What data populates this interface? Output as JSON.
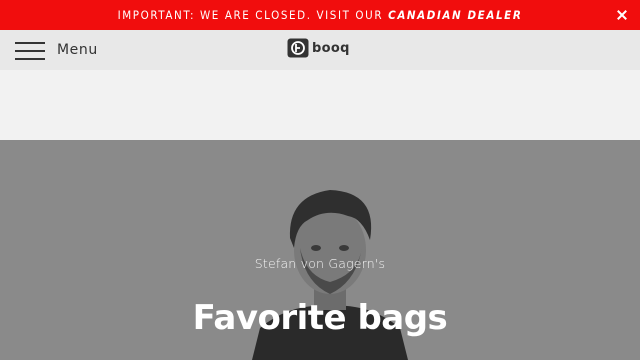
{
  "announcement": {
    "text": "IMPORTANT: WE ARE CLOSED. VISIT OUR",
    "link_text": "CANADIAN DEALER",
    "background": "#f10d0d"
  },
  "navbar": {
    "menu_label": "Menu",
    "menu_icon": "hamburger-icon",
    "logo_text": "booq",
    "logo_icon": "booq-logo-icon"
  },
  "hero": {
    "subtitle": "Stefan von Gagern's",
    "title": "Favorite bags"
  }
}
